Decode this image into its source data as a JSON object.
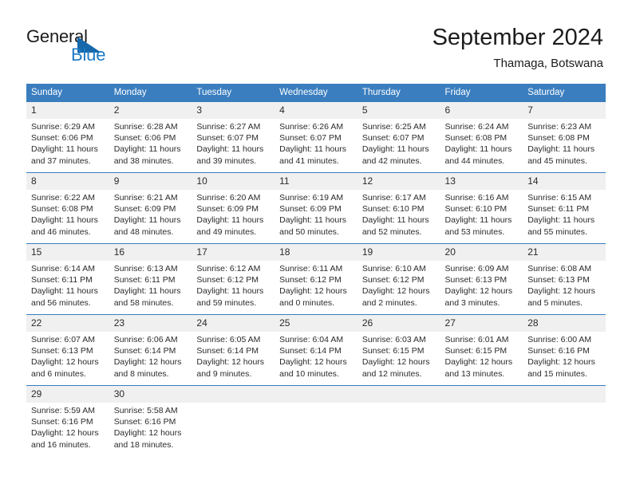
{
  "logo": {
    "word_top": "General",
    "word_bottom": "Blue",
    "triangle_color": "#1668ab",
    "blue_color": "#1f7ac4"
  },
  "header": {
    "title": "September 2024",
    "subtitle": "Thamaga, Botswana"
  },
  "theme": {
    "header_blue": "#3a7ebf",
    "daynum_band": "#f0f0f0",
    "text": "#2b2b2b"
  },
  "weekdays": [
    "Sunday",
    "Monday",
    "Tuesday",
    "Wednesday",
    "Thursday",
    "Friday",
    "Saturday"
  ],
  "weeks": [
    [
      {
        "day": "1",
        "sunrise": "Sunrise: 6:29 AM",
        "sunset": "Sunset: 6:06 PM",
        "daylight": "Daylight: 11 hours and 37 minutes."
      },
      {
        "day": "2",
        "sunrise": "Sunrise: 6:28 AM",
        "sunset": "Sunset: 6:06 PM",
        "daylight": "Daylight: 11 hours and 38 minutes."
      },
      {
        "day": "3",
        "sunrise": "Sunrise: 6:27 AM",
        "sunset": "Sunset: 6:07 PM",
        "daylight": "Daylight: 11 hours and 39 minutes."
      },
      {
        "day": "4",
        "sunrise": "Sunrise: 6:26 AM",
        "sunset": "Sunset: 6:07 PM",
        "daylight": "Daylight: 11 hours and 41 minutes."
      },
      {
        "day": "5",
        "sunrise": "Sunrise: 6:25 AM",
        "sunset": "Sunset: 6:07 PM",
        "daylight": "Daylight: 11 hours and 42 minutes."
      },
      {
        "day": "6",
        "sunrise": "Sunrise: 6:24 AM",
        "sunset": "Sunset: 6:08 PM",
        "daylight": "Daylight: 11 hours and 44 minutes."
      },
      {
        "day": "7",
        "sunrise": "Sunrise: 6:23 AM",
        "sunset": "Sunset: 6:08 PM",
        "daylight": "Daylight: 11 hours and 45 minutes."
      }
    ],
    [
      {
        "day": "8",
        "sunrise": "Sunrise: 6:22 AM",
        "sunset": "Sunset: 6:08 PM",
        "daylight": "Daylight: 11 hours and 46 minutes."
      },
      {
        "day": "9",
        "sunrise": "Sunrise: 6:21 AM",
        "sunset": "Sunset: 6:09 PM",
        "daylight": "Daylight: 11 hours and 48 minutes."
      },
      {
        "day": "10",
        "sunrise": "Sunrise: 6:20 AM",
        "sunset": "Sunset: 6:09 PM",
        "daylight": "Daylight: 11 hours and 49 minutes."
      },
      {
        "day": "11",
        "sunrise": "Sunrise: 6:19 AM",
        "sunset": "Sunset: 6:09 PM",
        "daylight": "Daylight: 11 hours and 50 minutes."
      },
      {
        "day": "12",
        "sunrise": "Sunrise: 6:17 AM",
        "sunset": "Sunset: 6:10 PM",
        "daylight": "Daylight: 11 hours and 52 minutes."
      },
      {
        "day": "13",
        "sunrise": "Sunrise: 6:16 AM",
        "sunset": "Sunset: 6:10 PM",
        "daylight": "Daylight: 11 hours and 53 minutes."
      },
      {
        "day": "14",
        "sunrise": "Sunrise: 6:15 AM",
        "sunset": "Sunset: 6:11 PM",
        "daylight": "Daylight: 11 hours and 55 minutes."
      }
    ],
    [
      {
        "day": "15",
        "sunrise": "Sunrise: 6:14 AM",
        "sunset": "Sunset: 6:11 PM",
        "daylight": "Daylight: 11 hours and 56 minutes."
      },
      {
        "day": "16",
        "sunrise": "Sunrise: 6:13 AM",
        "sunset": "Sunset: 6:11 PM",
        "daylight": "Daylight: 11 hours and 58 minutes."
      },
      {
        "day": "17",
        "sunrise": "Sunrise: 6:12 AM",
        "sunset": "Sunset: 6:12 PM",
        "daylight": "Daylight: 11 hours and 59 minutes."
      },
      {
        "day": "18",
        "sunrise": "Sunrise: 6:11 AM",
        "sunset": "Sunset: 6:12 PM",
        "daylight": "Daylight: 12 hours and 0 minutes."
      },
      {
        "day": "19",
        "sunrise": "Sunrise: 6:10 AM",
        "sunset": "Sunset: 6:12 PM",
        "daylight": "Daylight: 12 hours and 2 minutes."
      },
      {
        "day": "20",
        "sunrise": "Sunrise: 6:09 AM",
        "sunset": "Sunset: 6:13 PM",
        "daylight": "Daylight: 12 hours and 3 minutes."
      },
      {
        "day": "21",
        "sunrise": "Sunrise: 6:08 AM",
        "sunset": "Sunset: 6:13 PM",
        "daylight": "Daylight: 12 hours and 5 minutes."
      }
    ],
    [
      {
        "day": "22",
        "sunrise": "Sunrise: 6:07 AM",
        "sunset": "Sunset: 6:13 PM",
        "daylight": "Daylight: 12 hours and 6 minutes."
      },
      {
        "day": "23",
        "sunrise": "Sunrise: 6:06 AM",
        "sunset": "Sunset: 6:14 PM",
        "daylight": "Daylight: 12 hours and 8 minutes."
      },
      {
        "day": "24",
        "sunrise": "Sunrise: 6:05 AM",
        "sunset": "Sunset: 6:14 PM",
        "daylight": "Daylight: 12 hours and 9 minutes."
      },
      {
        "day": "25",
        "sunrise": "Sunrise: 6:04 AM",
        "sunset": "Sunset: 6:14 PM",
        "daylight": "Daylight: 12 hours and 10 minutes."
      },
      {
        "day": "26",
        "sunrise": "Sunrise: 6:03 AM",
        "sunset": "Sunset: 6:15 PM",
        "daylight": "Daylight: 12 hours and 12 minutes."
      },
      {
        "day": "27",
        "sunrise": "Sunrise: 6:01 AM",
        "sunset": "Sunset: 6:15 PM",
        "daylight": "Daylight: 12 hours and 13 minutes."
      },
      {
        "day": "28",
        "sunrise": "Sunrise: 6:00 AM",
        "sunset": "Sunset: 6:16 PM",
        "daylight": "Daylight: 12 hours and 15 minutes."
      }
    ],
    [
      {
        "day": "29",
        "sunrise": "Sunrise: 5:59 AM",
        "sunset": "Sunset: 6:16 PM",
        "daylight": "Daylight: 12 hours and 16 minutes."
      },
      {
        "day": "30",
        "sunrise": "Sunrise: 5:58 AM",
        "sunset": "Sunset: 6:16 PM",
        "daylight": "Daylight: 12 hours and 18 minutes."
      },
      null,
      null,
      null,
      null,
      null
    ]
  ]
}
